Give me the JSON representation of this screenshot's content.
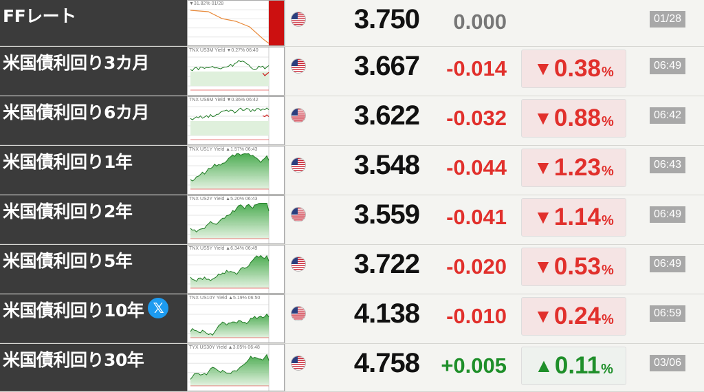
{
  "colors": {
    "down": "#e1302c",
    "up": "#1f8f2a",
    "flat": "#777777",
    "down_bg": "#f5e4e4",
    "up_bg": "#eef2ee"
  },
  "rows": [
    {
      "name": "FFレート",
      "cap": "▼31.82% 01/28",
      "price": "3.750",
      "change": "0.000",
      "dir": "flat",
      "pct": "",
      "time": "01/28",
      "icon": "us-flag-icon",
      "chart": "ff"
    },
    {
      "name": "米国債利回り3カ月",
      "cap": "TNX US3M Yield ▼0.27% 06:40",
      "price": "3.667",
      "change": "-0.014",
      "dir": "down",
      "pct": "0.38",
      "time": "06:49",
      "icon": "us-flag-icon",
      "chart": "flat"
    },
    {
      "name": "米国債利回り6カ月",
      "cap": "TNX US6M Yield ▼0.36% 06:42",
      "price": "3.622",
      "change": "-0.032",
      "dir": "down",
      "pct": "0.88",
      "time": "06:42",
      "icon": "us-flag-icon",
      "chart": "flat"
    },
    {
      "name": "米国債利回り1年",
      "cap": "TNX US1Y Yield ▲1.57% 06:43",
      "price": "3.548",
      "change": "-0.044",
      "dir": "down",
      "pct": "1.23",
      "time": "06:43",
      "icon": "us-flag-icon",
      "chart": "up"
    },
    {
      "name": "米国債利回り2年",
      "cap": "TNX US2Y Yield ▲5.20% 06:43",
      "price": "3.559",
      "change": "-0.041",
      "dir": "down",
      "pct": "1.14",
      "time": "06:49",
      "icon": "us-flag-icon",
      "chart": "up"
    },
    {
      "name": "米国債利回り5年",
      "cap": "TNX US5Y Yield ▲6.34% 06:49",
      "price": "3.722",
      "change": "-0.020",
      "dir": "down",
      "pct": "0.53",
      "time": "06:49",
      "icon": "us-flag-icon",
      "chart": "up"
    },
    {
      "name": "米国債利回り10年",
      "cap": "TNX US10Y Yield ▲5.19% 06:50",
      "price": "4.138",
      "change": "-0.010",
      "dir": "down",
      "pct": "0.24",
      "time": "06:59",
      "icon": "us-flag-icon",
      "chart": "up",
      "badge": "𝕏"
    },
    {
      "name": "米国債利回り30年",
      "cap": "TYX US30Y Yield ▲3.05% 06:48",
      "price": "4.758",
      "change": "+0.005",
      "dir": "up",
      "pct": "0.11",
      "time": "03/06",
      "icon": "us-flag-icon",
      "chart": "up"
    }
  ]
}
